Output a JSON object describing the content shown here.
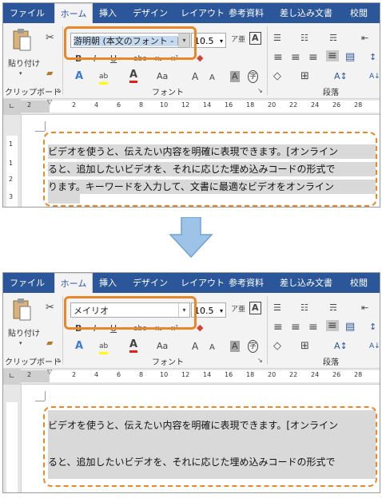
{
  "tabs": [
    "ファイル",
    "ホーム",
    "挿入",
    "デザイン",
    "レイアウト",
    "参考資料",
    "差し込み文書",
    "校閲"
  ],
  "active_tab": "ホーム",
  "clipboard": {
    "paste_label": "貼り付け",
    "group_label": "クリップボード"
  },
  "font_group": {
    "group_label": "フォント"
  },
  "paragraph_group": {
    "group_label": "段落"
  },
  "before": {
    "font_name": "游明朝 (本文のフォント - 日",
    "font_size": "10.5",
    "lines": [
      "ビデオを使うと、伝えたい内容を明確に表現できます。[オンライン",
      "ると、追加したいビデオを、それに応じた埋め込みコードの形式で",
      "ります。キーワードを入力して、文書に最適なビデオをオンライン"
    ]
  },
  "after": {
    "font_name": "メイリオ",
    "font_size": "10.5",
    "lines": [
      "ビデオを使うと、伝えたい内容を明確に表現できます。[オンライン",
      "ると、追加したいビデオを、それに応じた埋め込みコードの形式で"
    ]
  },
  "ruler_numbers": [
    "2",
    "2",
    "4",
    "6",
    "8",
    "10",
    "12",
    "14",
    "16",
    "18",
    "20",
    "22",
    "24",
    "26",
    "28"
  ],
  "icons": {
    "cut": "✂",
    "brush": "🖌",
    "bold": "B",
    "italic": "I",
    "underline": "U",
    "strike": "abc",
    "sub": "x₂",
    "sup": "x²",
    "textfx": "A",
    "highlight": "ab",
    "fontcolor": "A",
    "case": "Aa",
    "grow": "A",
    "shrink": "A",
    "shade": "A",
    "phon": "字",
    "bullets": "☰",
    "numbering": "☷",
    "multilevel": "☴",
    "indent": "⇤",
    "left": "≡",
    "center": "≡",
    "right": "≡",
    "justify": "≡",
    "distrib": "▤",
    "fill": "◇",
    "border": "⊞",
    "sortfx": "A↕",
    "launcher": "↘"
  },
  "colors": {
    "ribbon_tab": "#2b579a",
    "accent_orange": "#e8882a",
    "text_sel": "#c5d9ef",
    "doc_sel": "#d9d9d9",
    "arrow": "#9dc3e6"
  }
}
